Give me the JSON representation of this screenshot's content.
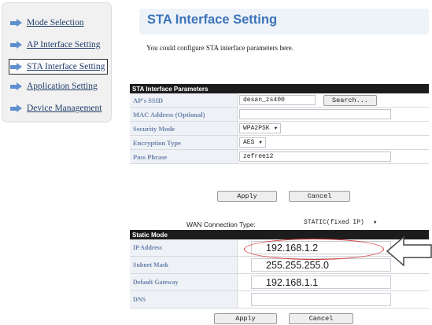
{
  "sidebar": {
    "items": [
      {
        "label": "Mode Selection",
        "active": false
      },
      {
        "label": "AP Interface Setting",
        "active": false
      },
      {
        "label": "STA Interface Setting",
        "active": true
      },
      {
        "label": "Application Setting",
        "active": false
      },
      {
        "label": "Device Management",
        "active": false
      }
    ]
  },
  "header": {
    "title": "STA Interface Setting",
    "intro": "You could configure STA interface parameters here."
  },
  "sta_params": {
    "heading": "STA Interface Parameters",
    "ssid_label": "AP's SSID",
    "ssid_value": "desan_zs400",
    "search_label": "Search...",
    "mac_label": "MAC Address (Optional)",
    "mac_value": "",
    "security_label": "Security Mode",
    "security_value": "WPA2PSK",
    "encryption_label": "Encryption Type",
    "encryption_value": "AES",
    "passphrase_label": "Pass Phrase",
    "passphrase_value": "zefree12",
    "apply_label": "Apply",
    "cancel_label": "Cancel"
  },
  "wan": {
    "label": "WAN Connection Type:",
    "value": "STATIC(fixed IP)"
  },
  "static_mode": {
    "heading": "Static Mode",
    "ip_label": "IP Address",
    "ip_value": "192.168.1.2",
    "mask_label": "Subnet Mask",
    "mask_value": "255.255.255.0",
    "gateway_label": "Default Gateway",
    "gateway_value": "192.168.1.1",
    "dns_label": "DNS",
    "dns_value": "",
    "apply_label": "Apply",
    "cancel_label": "Cancel"
  },
  "icons": {
    "nav_arrow": "arrow-right-icon",
    "dropdown": "chevron-down-icon",
    "pointer": "outline-arrow-left-icon"
  },
  "colors": {
    "title": "#3b74ba",
    "table_header": "#1c1c1c",
    "label_text": "#6c84ac",
    "highlight": "#d63b3b"
  }
}
